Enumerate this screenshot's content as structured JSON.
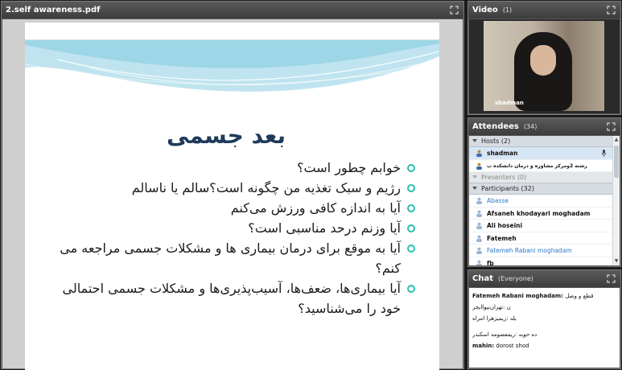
{
  "share": {
    "title": "2.self awareness.pdf",
    "slide": {
      "title": "بعد جسمی",
      "bullets": [
        "خوابم چطور است؟",
        "رژیم و سبک تغذیه من چگونه است؟سالم یا ناسالم",
        "آیا به اندازه کافی ورزش می‌کنم",
        "آیا وزنم درحد مناسبی است؟",
        "آیا به موقع برای درمان بیماری ها و مشکلات جسمی مراجعه می کنم؟",
        "آیا بیماری‌ها، ضعف‌ها، آسیب‌پذیری‌ها و مشکلات جسمی احتمالی خود را می‌شناسید؟"
      ],
      "accent_color": "#2bbfb0",
      "title_color": "#1f3a5a"
    }
  },
  "video": {
    "title": "Video",
    "count": "(1)",
    "camera_name": "shadman"
  },
  "attendees": {
    "title": "Attendees",
    "count": "(34)",
    "hosts_label": "Hosts (2)",
    "hosts": [
      "shadman",
      "رشته 2ومرکز مشاوره و درمان دانشکده ب"
    ],
    "presenters_label": "Presenters (0)",
    "participants_label": "Participants (32)",
    "participants": [
      "Abasse",
      "Afsaneh khodayari moghadam",
      "Ali hoseini",
      "Fatemeh",
      "Fatemeh Rabani moghadam",
      "fb"
    ]
  },
  "chat": {
    "title": "Chat",
    "scope": "(Everyone)",
    "messages": [
      {
        "author": "Fatemeh Rabani moghadam:",
        "text": "قطع و وصل"
      },
      {
        "author": "",
        "text": "ن :تهران‌نیوا‌ایجر"
      },
      {
        "author": "",
        "text": "بله :ریمیزهرا امراه"
      },
      {
        "author": "",
        "text": "ده حوبه :ریمعصومه اسکندر"
      },
      {
        "author": "mahin:",
        "text": "dorost shod"
      }
    ]
  }
}
